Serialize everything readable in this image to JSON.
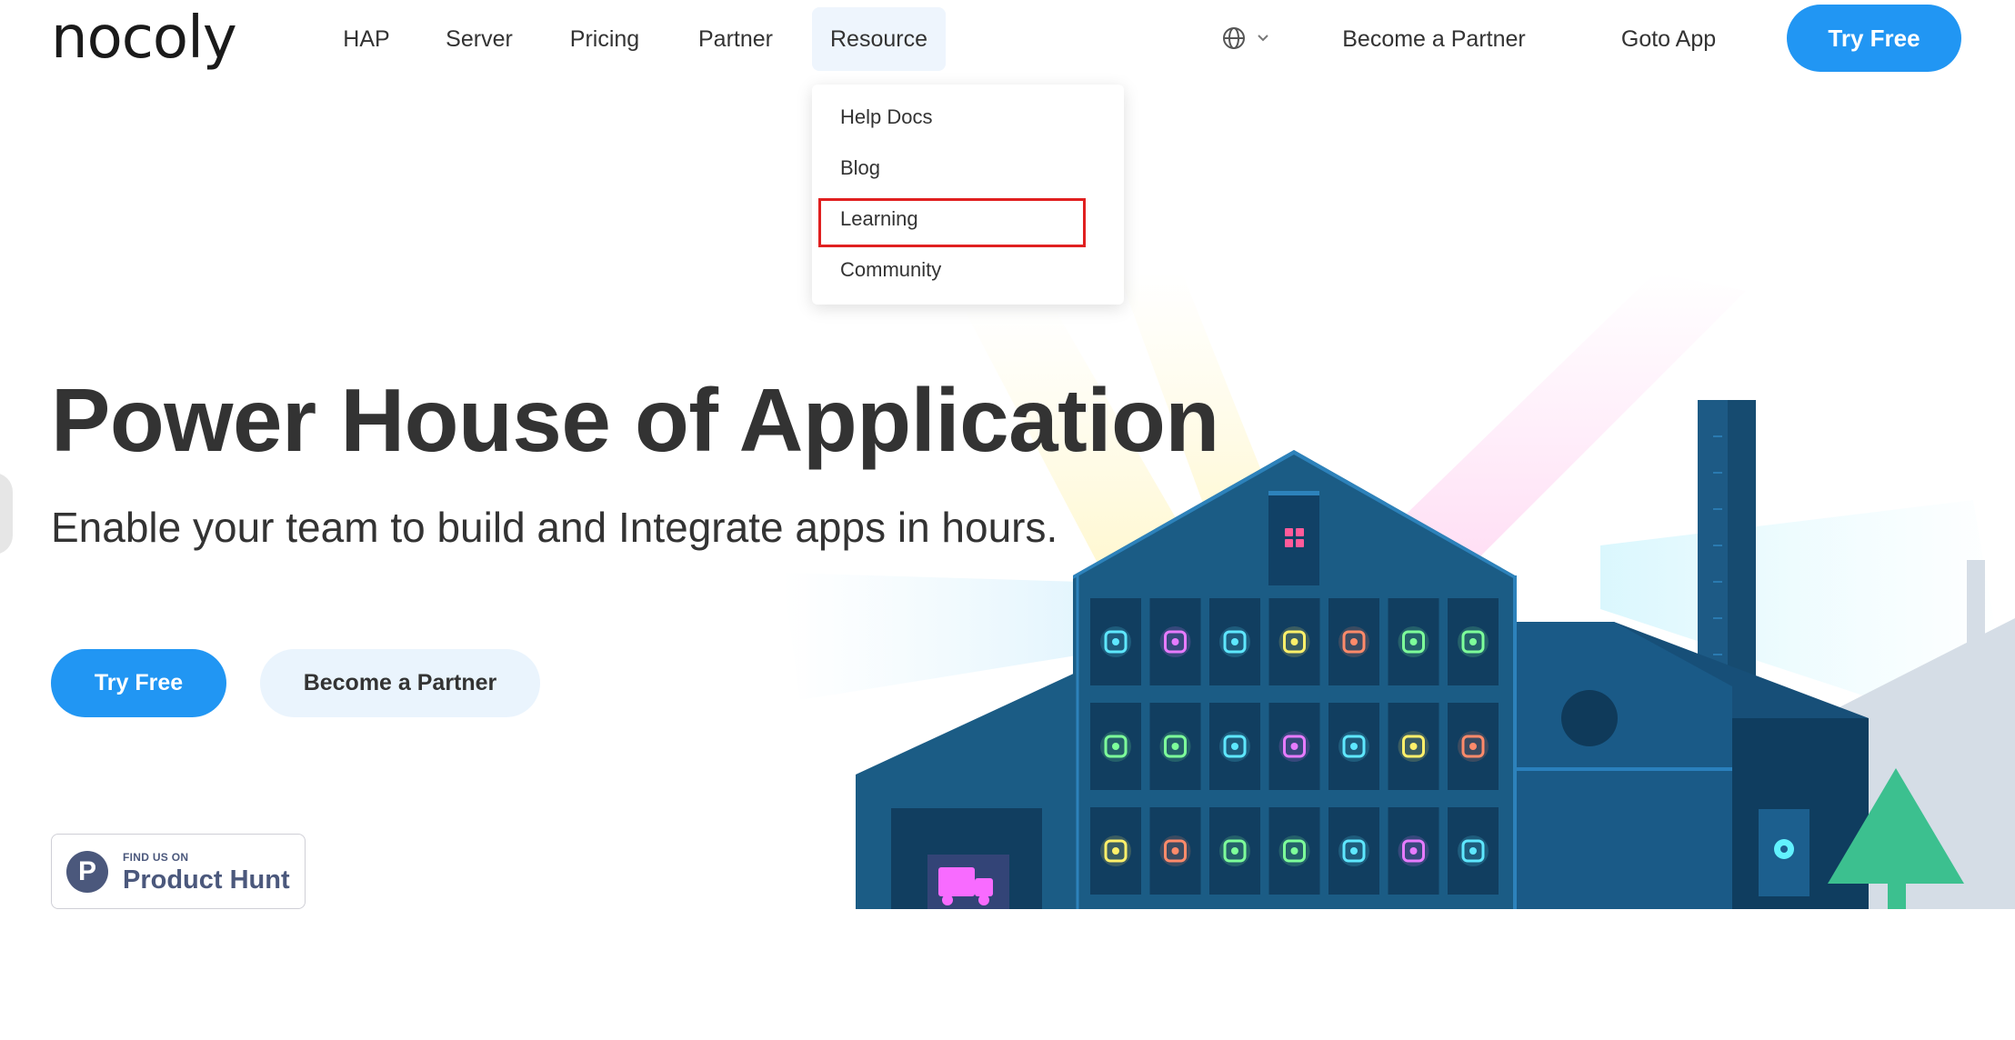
{
  "brand": {
    "logo_text": "nocoly",
    "accent_color": "#2196f3"
  },
  "nav": {
    "links": [
      {
        "label": "HAP"
      },
      {
        "label": "Server"
      },
      {
        "label": "Pricing"
      },
      {
        "label": "Partner"
      },
      {
        "label": "Resource",
        "active": true
      }
    ],
    "language_icon": "globe-icon",
    "become_partner_label": "Become a Partner",
    "goto_app_label": "Goto App",
    "try_free_label": "Try Free"
  },
  "resource_menu": {
    "items": [
      {
        "label": "Help Docs"
      },
      {
        "label": "Blog"
      },
      {
        "label": "Learning",
        "highlighted": true
      },
      {
        "label": "Community"
      }
    ],
    "highlight_color": "#e02020"
  },
  "hero": {
    "title": "Power House of Application",
    "subtitle": "Enable your team to build and Integrate apps in hours.",
    "try_free_label": "Try Free",
    "become_partner_label": "Become a Partner"
  },
  "product_hunt": {
    "small_text": "FIND US ON",
    "big_text": "Product Hunt",
    "logo_letter": "P"
  },
  "illustration": {
    "subject": "factory-house-illustration",
    "building_color": "#1b5c85",
    "icons": [
      "cube-icon",
      "spreadsheet-icon",
      "home-icon",
      "chart-icon",
      "receipt-icon",
      "dollar-icon",
      "calculator-icon",
      "edit-icon",
      "badge-check-icon",
      "leaf-icon",
      "pie-chart-icon",
      "presentation-icon",
      "handshake-icon",
      "trophy-icon",
      "coins-icon",
      "piggy-bank-icon",
      "chat-icon",
      "phone-icon",
      "mail-icon",
      "id-card-icon",
      "airplane-icon"
    ]
  }
}
